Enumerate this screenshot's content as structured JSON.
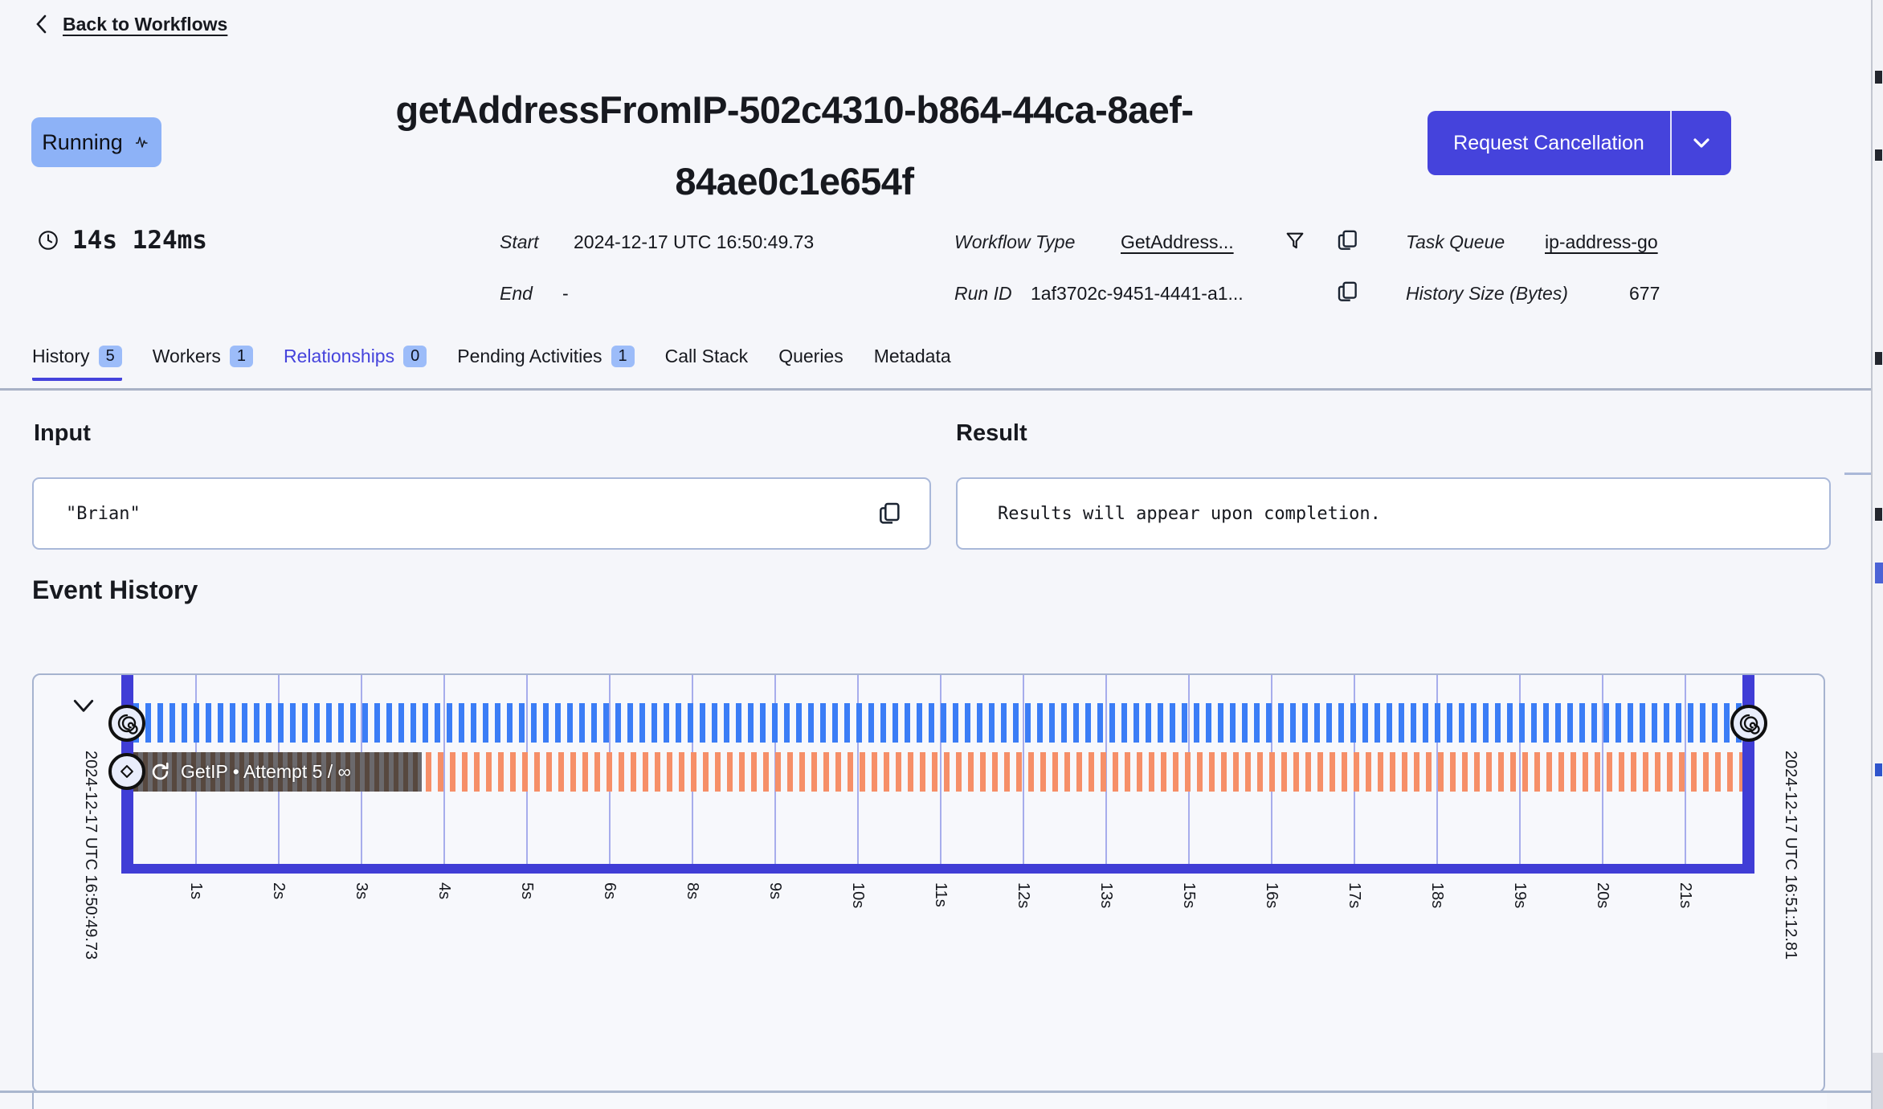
{
  "header": {
    "back_label": "Back to Workflows",
    "status": "Running",
    "title_line1": "getAddressFromIP-502c4310-b864-44ca-8aef-",
    "title_line2": "84ae0c1e654f",
    "cancel_button": "Request Cancellation"
  },
  "meta": {
    "duration": "14s 124ms",
    "start_label": "Start",
    "start_value": "2024-12-17 UTC 16:50:49.73",
    "end_label": "End",
    "end_value": "-",
    "workflow_type_label": "Workflow Type",
    "workflow_type_value": "GetAddress...",
    "run_id_label": "Run ID",
    "run_id_value": "1af3702c-9451-4441-a1...",
    "task_queue_label": "Task Queue",
    "task_queue_value": "ip-address-go",
    "history_size_label": "History Size (Bytes)",
    "history_size_value": "677"
  },
  "tabs": [
    {
      "label": "History",
      "badge": "5"
    },
    {
      "label": "Workers",
      "badge": "1"
    },
    {
      "label": "Relationships",
      "badge": "0"
    },
    {
      "label": "Pending Activities",
      "badge": "1"
    },
    {
      "label": "Call Stack"
    },
    {
      "label": "Queries"
    },
    {
      "label": "Metadata"
    }
  ],
  "input_section": {
    "heading": "Input",
    "value": "\"Brian\""
  },
  "result_section": {
    "heading": "Result",
    "value": "Results will appear upon completion."
  },
  "event_history": {
    "heading": "Event History",
    "start_timestamp": "2024-12-17 UTC 16:50:49.73",
    "end_timestamp": "2024-12-17 UTC 16:51:12.81",
    "activity_label": "GetIP • Attempt 5 / ∞",
    "ticks": [
      "1s",
      "2s",
      "3s",
      "4s",
      "5s",
      "6s",
      "8s",
      "9s",
      "10s",
      "11s",
      "12s",
      "13s",
      "15s",
      "16s",
      "17s",
      "18s",
      "19s",
      "20s",
      "21s"
    ]
  },
  "colors": {
    "accent": "#4543dc",
    "running_badge": "#8db2f7",
    "workflow_stripe": "#3b7df6",
    "activity_stripe": "#f68f68",
    "frame": "#403dd6",
    "panel_border": "#a6b3cf"
  }
}
